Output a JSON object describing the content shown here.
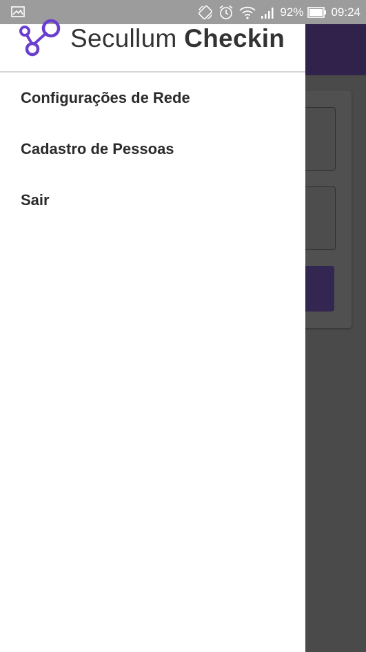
{
  "status_bar": {
    "battery_percent": "92%",
    "time": "09:24",
    "icons": [
      "image-icon",
      "rotate-icon",
      "alarm-icon",
      "wifi-icon",
      "signal-icon",
      "battery-icon"
    ]
  },
  "drawer": {
    "brand": {
      "name_light": "Secullum",
      "name_bold": "Checkin",
      "accent_color": "#6a3fd0"
    },
    "menu_items": [
      {
        "label": "Configurações de Rede"
      },
      {
        "label": "Cadastro de Pessoas"
      },
      {
        "label": "Sair"
      }
    ]
  },
  "colors": {
    "toolbar": "#30224a",
    "scrim_bg": "#4a4a4a",
    "status_bar": "#9c9c9c"
  }
}
